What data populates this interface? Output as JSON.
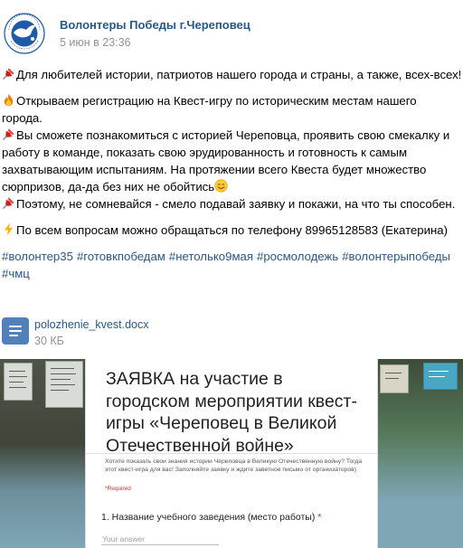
{
  "post": {
    "author": "Волонтеры Победы г.Череповец",
    "date": "5 июн в 23:36",
    "paragraphs": [
      {
        "emoji": "pushpin-icon",
        "lines": [
          "Для любителей истории, патриотов нашего города и страны, а также, всех-всех!"
        ]
      },
      {
        "emoji": "fire-icon",
        "lines": [
          "Открываем регистрацию на Квест-игру по историческим местам нашего",
          "города."
        ]
      },
      {
        "emoji": "pushpin-icon",
        "lines": [
          "Вы сможете познакомиться с историей Череповца, проявить свою смекалку и",
          "работу в команде, показать свою эрудированность и готовность к самым",
          "захватывающим испытаниям. На протяжении всего Квеста будет множество",
          "сюрпризов, да-да без них не обойтись"
        ],
        "trailing_emoji": "smile-icon"
      },
      {
        "emoji": "pushpin-icon",
        "lines": [
          "Поэтому, не сомневайся - смело подавай заявку и покажи, на что ты способен."
        ]
      },
      {
        "emoji": "lightning-icon",
        "lines": [
          "По всем вопросам можно обращаться по телефону 89965128583 (Екатерина)"
        ]
      }
    ],
    "hashtags_line1": [
      "#волонтер35",
      "#готовкпобедам",
      "#нетолько9мая",
      "#росмолодежь",
      "#волонтерыпобеды"
    ],
    "hashtags_line2": [
      "#чмц"
    ],
    "document": {
      "name": "polozhenie_kvest.docx",
      "size": "30 КБ"
    },
    "image": {
      "title": "ЗАЯВКА на участие в городском мероприятии квест-игры «Череповец в Великой Отечественной войне»",
      "intro": "Хотите показать свои знания истории Череповца в Великую Отечественную войну? Тогда этот квест-игра для вас! Заполняйте заявку и ждите заветное письмо от организаторов)",
      "required_note": "*Required",
      "question": "1. Название учебного заведения (место работы)",
      "required_star": "*",
      "answer_placeholder": "Your answer"
    },
    "colors": {
      "link": "#2a5885",
      "meta": "#939393",
      "doc_icon": "#5181b8",
      "required": "#d93025"
    }
  }
}
